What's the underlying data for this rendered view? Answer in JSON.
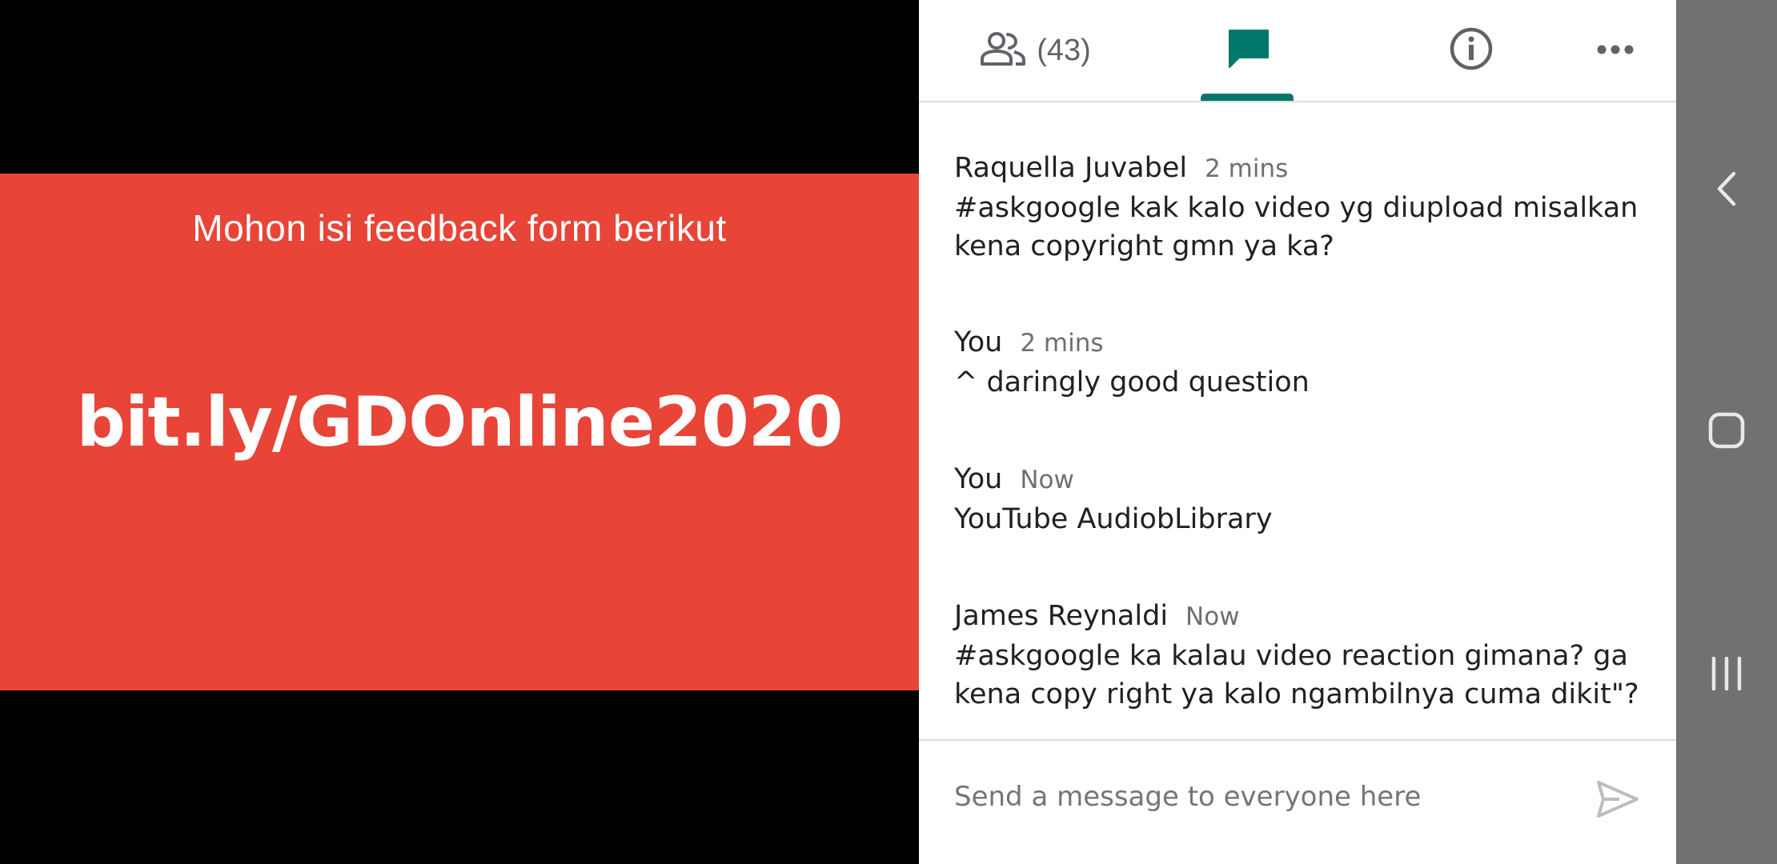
{
  "slide": {
    "background_color": "#E84437",
    "subtitle": "Mohon isi feedback form berikut",
    "url": "bit.ly/GDOnline2020"
  },
  "tabs": {
    "people_icon": "people-icon",
    "people_count": "(43)",
    "chat_icon": "chat-icon",
    "info_icon": "info-icon",
    "more_icon": "more-icon",
    "active_tab": "chat",
    "accent_color": "#00796B"
  },
  "messages": [
    {
      "sender": "Raquella Juvabel",
      "time": "2 mins",
      "lines": [
        "#askgoogle kak kalo video yg diupload misalkan",
        "kena copyright gmn ya ka?"
      ]
    },
    {
      "sender": "You",
      "time": "2 mins",
      "lines": [
        "^ daringly good question"
      ]
    },
    {
      "sender": "You",
      "time": "Now",
      "lines": [
        "YouTube AudiobLibrary"
      ]
    },
    {
      "sender": "James Reynaldi",
      "time": "Now",
      "lines": [
        "#askgoogle ka kalau video reaction gimana? ga",
        "kena copy right ya kalo ngambilnya cuma dikit\"?"
      ]
    }
  ],
  "composer": {
    "placeholder": "Send a message to everyone here",
    "send_icon": "send-icon"
  },
  "nav": {
    "back_icon": "back-icon",
    "home_icon": "home-icon",
    "recents_icon": "recents-icon"
  }
}
